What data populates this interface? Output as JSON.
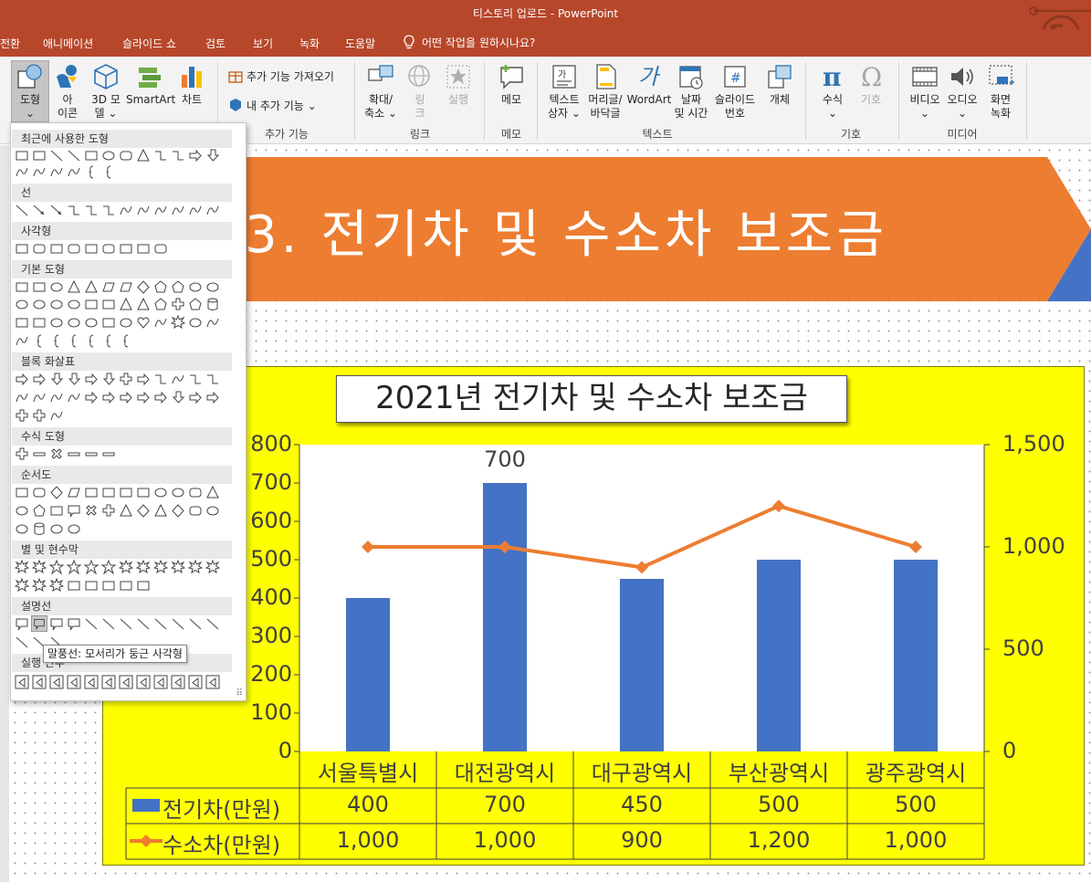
{
  "window": {
    "title": "티스토리 업로드  -  PowerPoint"
  },
  "tabs": [
    "전환",
    "애니메이션",
    "슬라이드 쇼",
    "검토",
    "보기",
    "녹화",
    "도움말"
  ],
  "tell_me": "어떤 작업을 원하시나요?",
  "ribbon": {
    "illustrations": {
      "shapes": "도형",
      "icons": [
        "아",
        "이콘"
      ],
      "models3d": [
        "3D 모",
        "델"
      ],
      "smartart": "SmartArt",
      "chart": "차트"
    },
    "addins": {
      "get": "추가 기능 가져오기",
      "my": "내 추가 기능",
      "label": "추가 기능"
    },
    "links": {
      "zoom": [
        "확대/",
        "축소"
      ],
      "link": [
        "링",
        "크"
      ],
      "action": "실행",
      "label": "링크"
    },
    "comments": {
      "comment": "메모",
      "label": "메모"
    },
    "text": {
      "textbox": [
        "텍스트",
        "상자"
      ],
      "header": [
        "머리글/",
        "바닥글"
      ],
      "wordart": "WordArt",
      "datetime": [
        "날짜",
        "및 시간"
      ],
      "slidenum": [
        "슬라이드",
        "번호"
      ],
      "object": "개체",
      "label": "텍스트"
    },
    "symbols": {
      "equation": "수식",
      "symbol": "기호",
      "label": "기호"
    },
    "media": {
      "video": "비디오",
      "audio": "오디오",
      "screenrec": [
        "화면",
        "녹화"
      ],
      "label": "미디어"
    }
  },
  "shapes_gallery": {
    "sections": [
      "최근에 사용한 도형",
      "선",
      "사각형",
      "기본 도형",
      "블록 화살표",
      "수식 도형",
      "순서도",
      "별 및 현수막",
      "설명선",
      "실행 단추"
    ],
    "tooltip": "말풍선: 모서리가 둥근 사각형"
  },
  "slide": {
    "title": "3. 전기차 및 수소차 보조금",
    "banner_color": "#ed7d31",
    "accent_color": "#4472c4"
  },
  "chart_data": {
    "type": "bar",
    "title": "2021년 전기차 및 수소차 보조금",
    "categories": [
      "서울특별시",
      "대전광역시",
      "대구광역시",
      "부산광역시",
      "광주광역시"
    ],
    "series": [
      {
        "name": "전기차(만원)",
        "kind": "bar",
        "axis": "left",
        "color": "#4472c4",
        "values": [
          400,
          700,
          450,
          500,
          500
        ],
        "display": [
          "400",
          "700",
          "450",
          "500",
          "500"
        ]
      },
      {
        "name": "수소차(만원)",
        "kind": "line",
        "axis": "right",
        "color": "#ed7d31",
        "values": [
          1000,
          1000,
          900,
          1200,
          1000
        ],
        "display": [
          "1,000",
          "1,000",
          "900",
          "1,200",
          "1,000"
        ]
      }
    ],
    "y_left": {
      "range": [
        0,
        800
      ],
      "ticks": [
        "0",
        "100",
        "200",
        "300",
        "400",
        "500",
        "600",
        "700",
        "800"
      ]
    },
    "y_right": {
      "range": [
        0,
        1500
      ],
      "ticks": [
        "0",
        "500",
        "1,000",
        "1,500"
      ]
    },
    "data_labels": {
      "series": 0,
      "index": 1,
      "text": "700"
    },
    "data_table": true,
    "background": "#ffff00"
  }
}
